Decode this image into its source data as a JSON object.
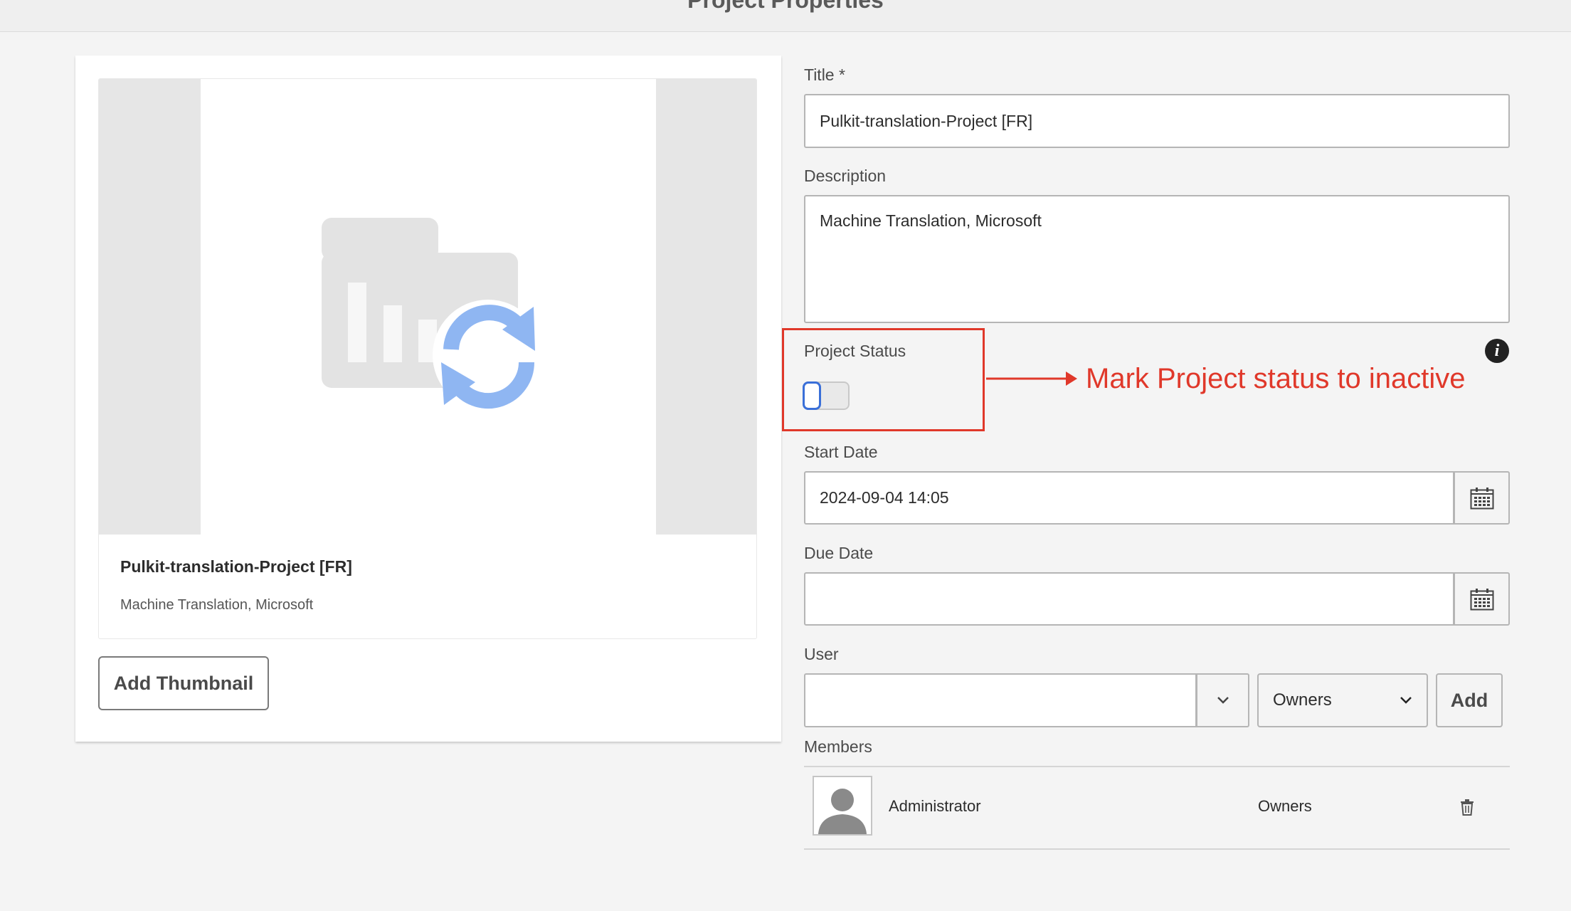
{
  "header": {
    "title": "Project Properties"
  },
  "card": {
    "title": "Pulkit-translation-Project [FR]",
    "description": "Machine Translation, Microsoft"
  },
  "buttons": {
    "add_thumbnail": "Add Thumbnail",
    "add": "Add"
  },
  "form": {
    "title_label": "Title *",
    "title_value": "Pulkit-translation-Project [FR]",
    "description_label": "Description",
    "description_value": "Machine Translation, Microsoft",
    "status_label": "Project Status",
    "status_active": false,
    "start_date_label": "Start Date",
    "start_date_value": "2024-09-04 14:05",
    "due_date_label": "Due Date",
    "due_date_value": "",
    "user_label": "User",
    "user_value": "",
    "role_selected": "Owners",
    "members_label": "Members"
  },
  "members": [
    {
      "name": "Administrator",
      "role": "Owners"
    }
  ],
  "annotation": {
    "text": "Mark Project status to inactive",
    "color": "#e0382a"
  },
  "icons": {
    "info": "info-icon",
    "calendar": "calendar-icon",
    "chevron": "chevron-down-icon",
    "trash": "trash-icon",
    "avatar": "user-avatar-icon"
  },
  "colors": {
    "accent_blue": "#3a6fd8",
    "thumbnail_sync_blue": "#8fb6f2"
  }
}
